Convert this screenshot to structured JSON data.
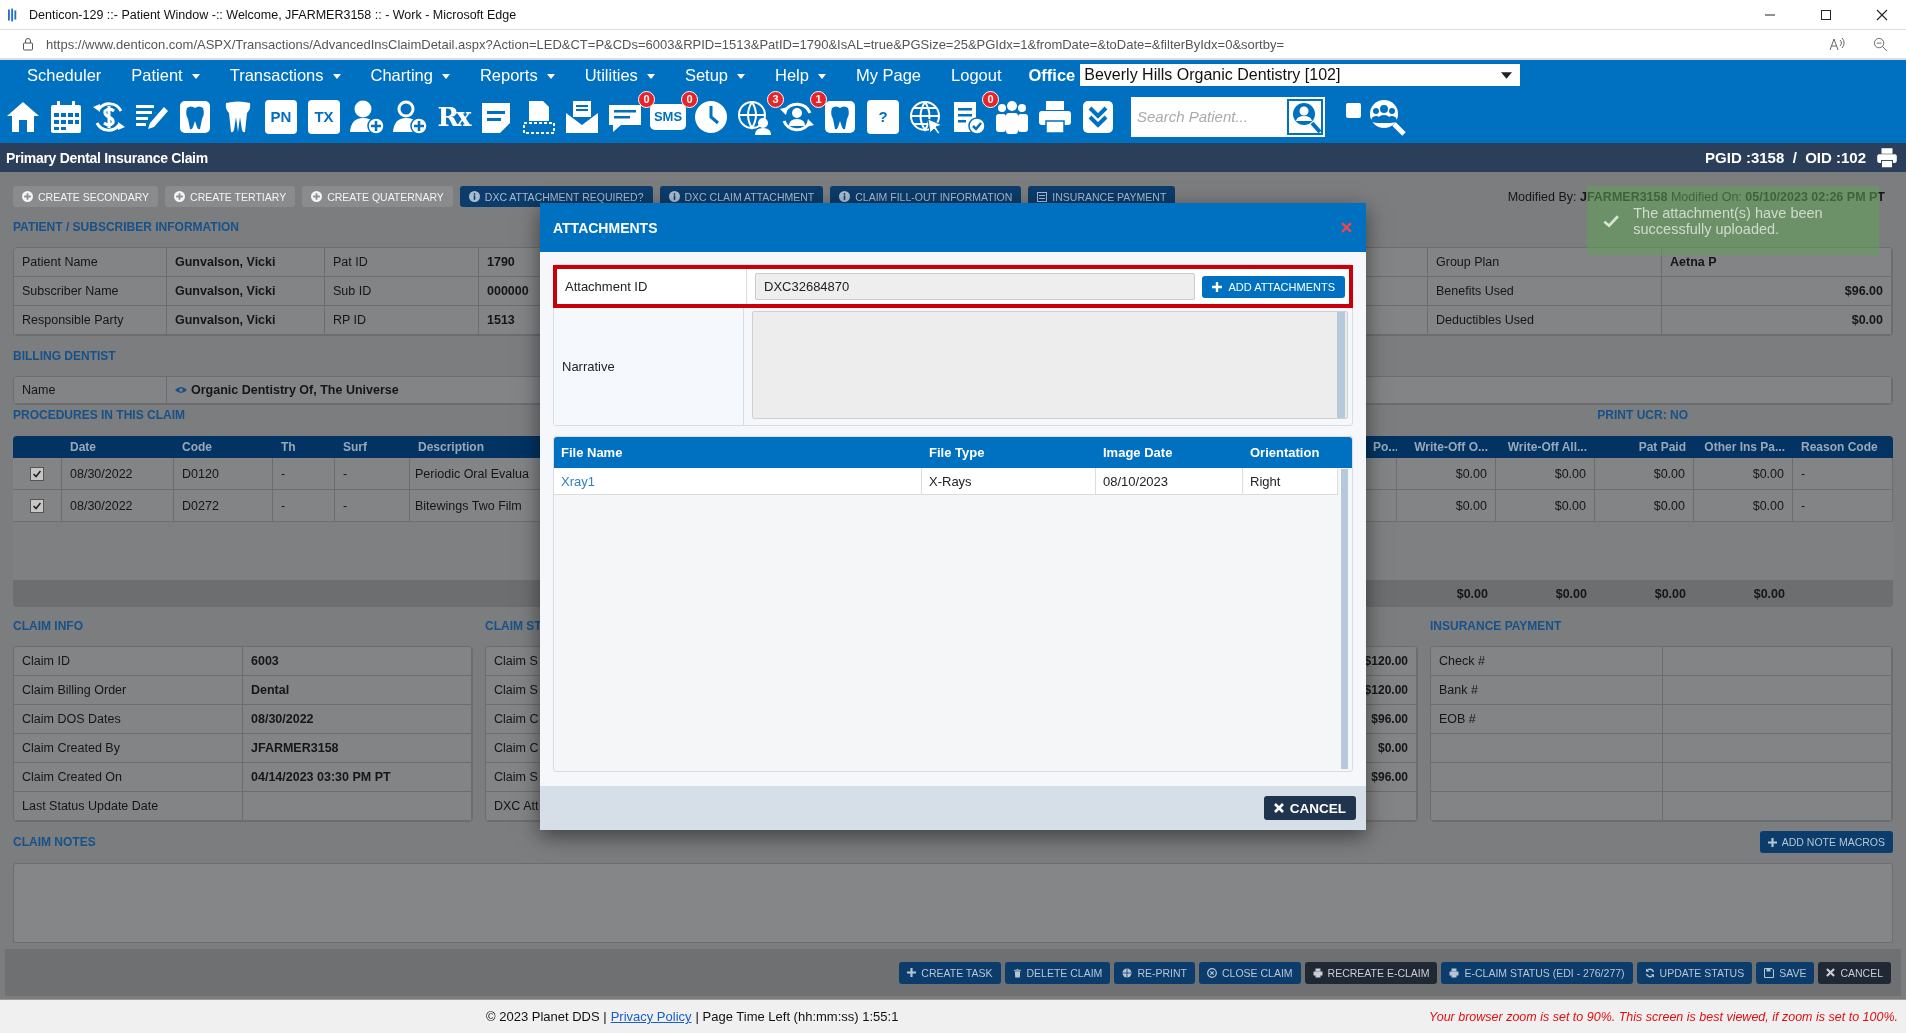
{
  "browser": {
    "title": "Denticon-129 ::- Patient Window -:: Welcome, JFARMER3158 :: - Work - Microsoft Edge",
    "url": "https://www.denticon.com/ASPX/Transactions/AdvancedInsClaimDetail.aspx?Action=LED&CT=P&CDs=6003&RPID=1513&PatID=1790&IsAL=true&PGSize=25&PGIdx=1&fromDate=&toDate=&filterByIdx=0&sortby="
  },
  "menu": {
    "items": [
      {
        "label": "Scheduler",
        "dropdown": false
      },
      {
        "label": "Patient",
        "dropdown": true
      },
      {
        "label": "Transactions",
        "dropdown": true
      },
      {
        "label": "Charting",
        "dropdown": true
      },
      {
        "label": "Reports",
        "dropdown": true
      },
      {
        "label": "Utilities",
        "dropdown": true
      },
      {
        "label": "Setup",
        "dropdown": true
      },
      {
        "label": "Help",
        "dropdown": true
      },
      {
        "label": "My Page",
        "dropdown": false
      },
      {
        "label": "Logout",
        "dropdown": false
      }
    ],
    "office_label": "Office",
    "office_value": "Beverly Hills Organic Dentistry [102]"
  },
  "toolbar": {
    "items": [
      {
        "kind": "home"
      },
      {
        "kind": "calendar"
      },
      {
        "kind": "dollar"
      },
      {
        "kind": "edit"
      },
      {
        "kind": "tooth-tile"
      },
      {
        "kind": "tooth"
      },
      {
        "kind": "tile",
        "label": "PN"
      },
      {
        "kind": "tile",
        "label": "TX"
      },
      {
        "kind": "user-add"
      },
      {
        "kind": "users-add"
      },
      {
        "kind": "text",
        "label": "Rx"
      },
      {
        "kind": "note"
      },
      {
        "kind": "scanner"
      },
      {
        "kind": "mail"
      },
      {
        "kind": "chat",
        "badge": "0"
      },
      {
        "kind": "bubble",
        "label": "SMS",
        "badge": "0"
      },
      {
        "kind": "clock"
      },
      {
        "kind": "globe-user",
        "badge": "3"
      },
      {
        "kind": "sync-user",
        "badge": "1"
      },
      {
        "kind": "tooth-tile"
      },
      {
        "kind": "tile",
        "label": "?"
      },
      {
        "kind": "globe-pointer"
      },
      {
        "kind": "doc-check",
        "badge": "0"
      },
      {
        "kind": "people"
      },
      {
        "kind": "printer"
      },
      {
        "kind": "chevrons"
      }
    ],
    "search": {
      "placeholder": "Search Patient..."
    },
    "checkbox": {
      "checked": false
    }
  },
  "page_header": {
    "title": "Primary Dental Insurance Claim",
    "ids": "PGID :3158  /  OID :102"
  },
  "action_buttons": [
    {
      "label": "CREATE SECONDARY",
      "kind": "plus",
      "disabled": true
    },
    {
      "label": "CREATE TERTIARY",
      "kind": "plus",
      "disabled": true
    },
    {
      "label": "CREATE QUATERNARY",
      "kind": "plus",
      "disabled": true
    },
    {
      "label": "DXC ATTACHMENT REQUIRED?",
      "kind": "info",
      "disabled": false
    },
    {
      "label": "DXC CLAIM ATTACHMENT",
      "kind": "info",
      "disabled": false
    },
    {
      "label": "CLAIM FILL-OUT INFORMATION",
      "kind": "info",
      "disabled": false
    },
    {
      "label": "INSURANCE PAYMENT",
      "kind": "list",
      "disabled": false
    }
  ],
  "modified": "Modified By: **JFARMER3158** Modified On: **05/10/2023 02:26 PM PT**",
  "toast": "The attachment(s) have been successfully uploaded.",
  "patient_info": {
    "heading": "PATIENT / SUBSCRIBER INFORMATION",
    "rows": [
      {
        "label": "Patient Name",
        "value": "Gunvalson, Vicki",
        "id_label": "Pat ID",
        "id_value": "1790",
        "right_label": "Group Plan",
        "right_value": "Aetna P"
      },
      {
        "label": "Subscriber Name",
        "value": "Gunvalson, Vicki",
        "id_label": "Sub ID",
        "id_value": "000000",
        "right_label": "Benefits Used",
        "right_value": "$96.00"
      },
      {
        "label": "Responsible Party",
        "value": "Gunvalson, Vicki",
        "id_label": "RP ID",
        "id_value": "1513",
        "right_label": "Deductibles Used",
        "right_value": "$0.00"
      }
    ]
  },
  "billing_dentist": {
    "heading": "BILLING DENTIST",
    "label": "Name",
    "value": "Organic Dentistry Of, The Universe"
  },
  "procedures": {
    "heading": "PROCEDURES IN THIS CLAIM",
    "print_ucr": "PRINT UCR: NO",
    "left_columns": [
      "Date",
      "Code",
      "Th",
      "Surf",
      "Description"
    ],
    "right_columns": [
      "Po...",
      "Write-Off O...",
      "Write-Off All...",
      "Pat Paid",
      "Other Ins Pa...",
      "Reason Code"
    ],
    "rows": [
      {
        "checked": true,
        "left": [
          "08/30/2022",
          "D0120",
          "-",
          "-",
          "Periodic Oral Evalua"
        ],
        "right": [
          "$0.00",
          "$0.00",
          "$0.00",
          "$0.00",
          "-"
        ]
      },
      {
        "checked": true,
        "left": [
          "08/30/2022",
          "D0272",
          "-",
          "-",
          "Bitewings Two Film"
        ],
        "right": [
          "$0.00",
          "$0.00",
          "$0.00",
          "$0.00",
          "-"
        ]
      }
    ],
    "totals": [
      "$0.00",
      "$0.00",
      "$0.00",
      "$0.00"
    ]
  },
  "claim_info": {
    "heading": "CLAIM INFO",
    "rows": [
      {
        "label": "Claim ID",
        "value": "6003"
      },
      {
        "label": "Claim Billing Order",
        "value": "Dental"
      },
      {
        "label": "Claim DOS Dates",
        "value": "08/30/2022"
      },
      {
        "label": "Claim Created By",
        "value": "JFARMER3158"
      },
      {
        "label": "Claim Created On",
        "value": "04/14/2023 03:30 PM PT"
      },
      {
        "label": "Last Status Update Date"
      }
    ]
  },
  "claim_status": {
    "heading": "CLAIM ST",
    "labels": [
      "Claim S",
      "Claim S",
      "Claim C",
      "Claim C",
      "Claim S",
      "DXC Att"
    ],
    "values": [
      "$120.00",
      "$120.00",
      "$96.00",
      "$0.00",
      "$96.00"
    ]
  },
  "insurance_payment": {
    "heading": "INSURANCE PAYMENT",
    "labels": [
      "Check #",
      "Bank #",
      "EOB #"
    ]
  },
  "claim_notes": {
    "heading": "CLAIM NOTES",
    "button": "ADD NOTE MACROS"
  },
  "bottom_buttons": [
    {
      "label": "CREATE TASK",
      "kind": "plus",
      "dark": false
    },
    {
      "label": "DELETE CLAIM",
      "kind": "trash",
      "dark": false
    },
    {
      "label": "RE-PRINT",
      "kind": "globe",
      "dark": false
    },
    {
      "label": "CLOSE CLAIM",
      "kind": "close-circle",
      "dark": false
    },
    {
      "label": "RECREATE E-CLAIM",
      "kind": "printer",
      "dark": true
    },
    {
      "label": "E-CLAIM STATUS (EDI - 276/277)",
      "kind": "printer",
      "dark": false
    },
    {
      "label": "UPDATE STATUS",
      "kind": "refresh",
      "dark": false
    },
    {
      "label": "SAVE",
      "kind": "save",
      "dark": false
    },
    {
      "label": "CANCEL",
      "kind": "x",
      "dark": true
    }
  ],
  "footer": {
    "copyright": "© 2023 Planet DDS |",
    "link": "Privacy Policy",
    "time": "| Page Time Left (hh:mm:ss) 1:55:1",
    "notice": "Your browser zoom is set to 90%. This screen is best viewed, if zoom is set to 100%."
  },
  "modal": {
    "title": "ATTACHMENTS",
    "attachment_label": "Attachment ID",
    "attachment_value": "DXC32684870",
    "add_button": "ADD ATTACHMENTS",
    "narrative_label": "Narrative",
    "columns": [
      "File Name",
      "File Type",
      "Image Date",
      "Orientation"
    ],
    "rows": [
      {
        "cells": [
          "Xray1",
          "X-Rays",
          "08/10/2023",
          "Right"
        ]
      }
    ],
    "cancel": "CANCEL"
  }
}
